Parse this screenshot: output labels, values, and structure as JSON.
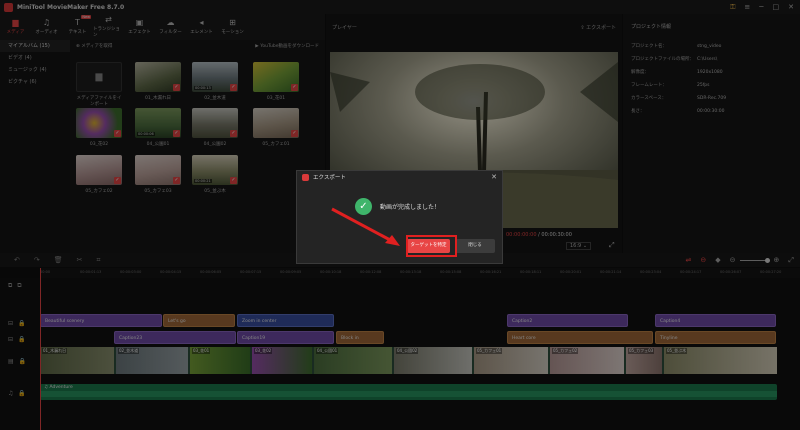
{
  "app": {
    "title": "MiniTool MovieMaker Free 8.7.0"
  },
  "toolbar": {
    "items": [
      {
        "label": "メディア",
        "icon": "folder-icon"
      },
      {
        "label": "オーディオ",
        "icon": "music-icon"
      },
      {
        "label": "テキスト",
        "icon": "text-icon",
        "badge": "New"
      },
      {
        "label": "トランジション",
        "icon": "transition-icon"
      },
      {
        "label": "エフェクト",
        "icon": "effects-icon"
      },
      {
        "label": "フィルター",
        "icon": "filter-icon"
      },
      {
        "label": "エレメント",
        "icon": "element-icon"
      },
      {
        "label": "モーション",
        "icon": "motion-icon"
      }
    ]
  },
  "sidebar": {
    "items": [
      {
        "label": "マイアルバム (15)"
      },
      {
        "label": "ビデオ (4)"
      },
      {
        "label": "ミュージック (4)"
      },
      {
        "label": "ピクチャ (6)"
      }
    ]
  },
  "media": {
    "import_label": "メディアを取得",
    "youtube_label": "YouTube動画をダウンロード",
    "import_tile_caption": "メディアファイルをインポート",
    "thumbs": [
      {
        "caption": "01_木漏れ日",
        "duration": ""
      },
      {
        "caption": "02_並木道",
        "duration": "00:00:13"
      },
      {
        "caption": "03_花01",
        "duration": ""
      },
      {
        "caption": "03_花02",
        "duration": ""
      },
      {
        "caption": "04_公園01",
        "duration": "00:00:06"
      },
      {
        "caption": "04_公園02",
        "duration": ""
      },
      {
        "caption": "05_カフェ01",
        "duration": ""
      },
      {
        "caption": "05_カフェ02",
        "duration": ""
      },
      {
        "caption": "05_カフェ03",
        "duration": ""
      },
      {
        "caption": "05_並ぶ木",
        "duration": "00:00:21"
      }
    ]
  },
  "player": {
    "label": "プレイヤー",
    "export_label": "エクスポート",
    "time_current": "00:00:00:00",
    "time_total": "00:00:30:00",
    "ratio": "16:9"
  },
  "props": {
    "title": "プロジェクト情報",
    "rows": [
      {
        "k": "プロジェクト名：",
        "v": "stng_video"
      },
      {
        "k": "プロジェクトファイルの場所：",
        "v": "C:\\Users\\"
      },
      {
        "k": "解像度：",
        "v": "1920x1080"
      },
      {
        "k": "フレームレート：",
        "v": "25fps"
      },
      {
        "k": "カラースペース：",
        "v": "SDR-Rec.709"
      },
      {
        "k": "長さ：",
        "v": "00:00:30:00"
      }
    ]
  },
  "ruler": {
    "ticks": [
      "00:00",
      "00:00:01:13",
      "00:00:03:00",
      "00:00:04:15",
      "00:00:06:05",
      "00:00:07:15",
      "00:00:09:05",
      "00:00:10:18",
      "00:00:12:08",
      "00:00:13:18",
      "00:00:15:08",
      "00:00:16:21",
      "00:00:18:11",
      "00:00:20:01",
      "00:00:21:14",
      "00:00:23:04",
      "00:00:24:17",
      "00:00:26:07",
      "00:00:27:20"
    ]
  },
  "timeline": {
    "row1": [
      "Beautiful scenery",
      "Let's go",
      "Zoom in center",
      "Caption2",
      "Caption4"
    ],
    "row2": [
      "Caption23",
      "Caption19",
      "Block in",
      "Heart core",
      "Tinyline"
    ],
    "video_clips": [
      "01_木漏れ日",
      "02_並木道",
      "03_花01",
      "03_花02",
      "04_公園01",
      "04_公園02",
      "05_カフェ01",
      "05_カフェ02",
      "05_カフェ03",
      "05_並ぶ木"
    ],
    "audio": "Adventure"
  },
  "dialog": {
    "title": "エクスポート",
    "message": "動画が完成しました！",
    "primary": "ターゲットを特定",
    "secondary": "閉じる"
  },
  "colors": {
    "accent": "#e84545",
    "success": "#3fb56b"
  }
}
